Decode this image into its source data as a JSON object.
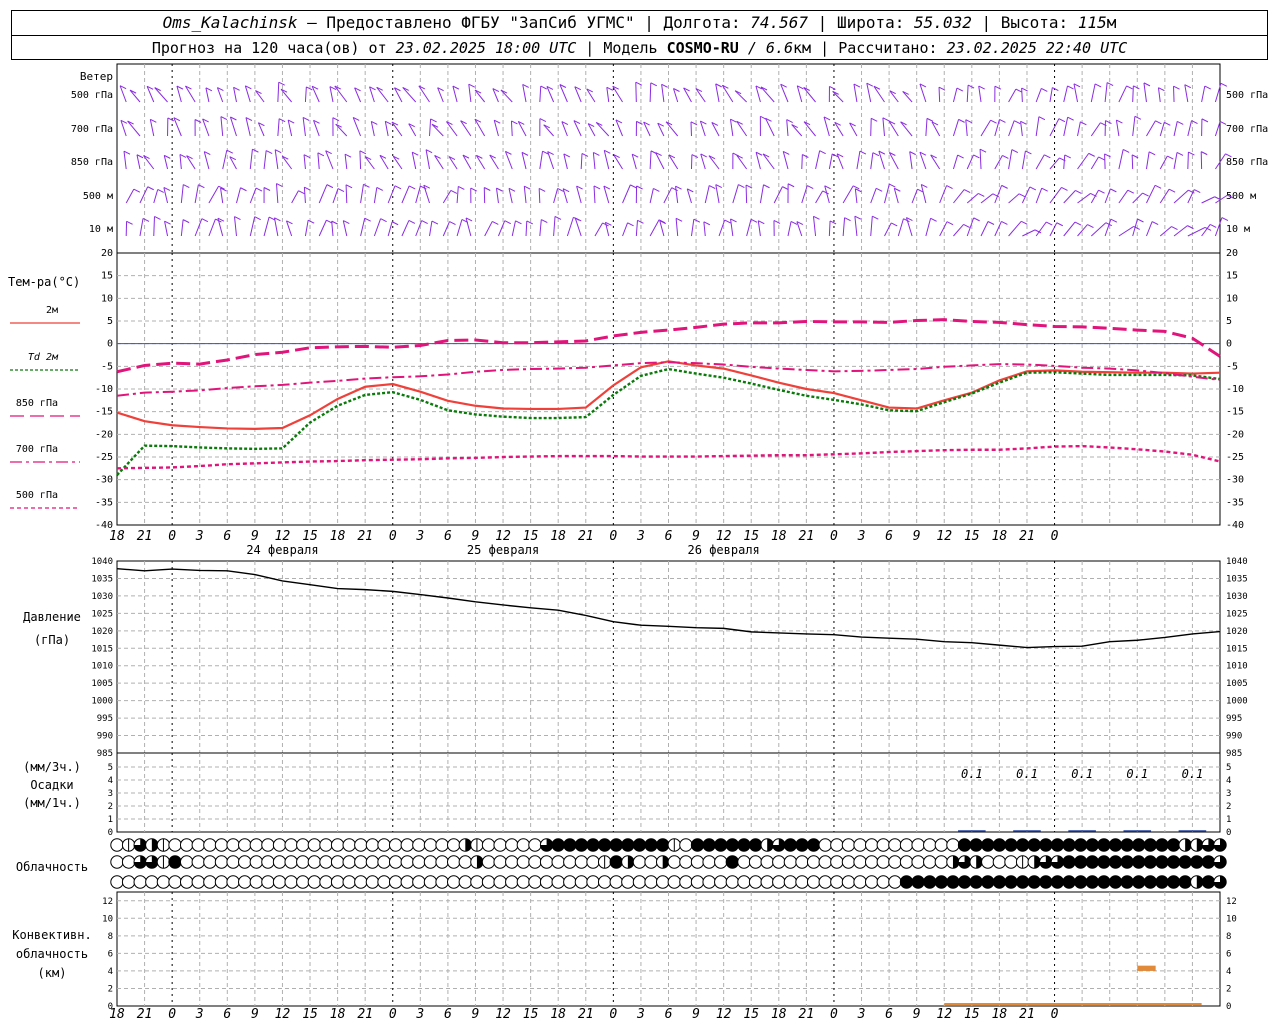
{
  "header": {
    "station": "Oms_Kalachinsk",
    "dash": " – ",
    "provider": "Предоставлено ФГБУ \"ЗапСиб УГМС\"",
    "lon_label": "Долгота:",
    "lon_value": "74.567",
    "lat_label": "Широта:",
    "lat_value": "55.032",
    "alt_label": "Высота:",
    "alt_value": "115",
    "alt_unit": "м",
    "sep": " | ",
    "forecast_prefix": "Прогноз на 120 часа(ов) от ",
    "forecast_time": "23.02.2025 18:00 UTC",
    "model_label": "Модель ",
    "model_name": "COSMO-RU",
    "model_res": " / 6.6",
    "model_res_unit": "км",
    "calc_label": "Рассчитано: ",
    "calc_time": "23.02.2025 22:40 UTC"
  },
  "chart_data": [
    {
      "type": "wind-barbs",
      "label": "Ветер",
      "levels": [
        "500 гПа",
        "700 гПа",
        "850 гПа",
        "500 м",
        "10 м"
      ],
      "color": "#8a2be2"
    },
    {
      "type": "line",
      "label": "Тем-ра(°C)",
      "ylim": [
        -40,
        20
      ],
      "yticks": [
        20,
        15,
        10,
        5,
        0,
        -5,
        -10,
        -15,
        -20,
        -25,
        -30,
        -35,
        -40
      ],
      "x": [
        0,
        3,
        6,
        9,
        12,
        15,
        18,
        21,
        24,
        27,
        30,
        33,
        36,
        39,
        42,
        45,
        48,
        51,
        54,
        57,
        60,
        63,
        66,
        69,
        72,
        75,
        78,
        81,
        84,
        87,
        90,
        93,
        96,
        99,
        102,
        105,
        108,
        111,
        114,
        117,
        120
      ],
      "series": [
        {
          "name": "2м",
          "color": "#f0403a",
          "dash": "solid",
          "values": [
            -15.2,
            -17.1,
            -18.0,
            -18.4,
            -18.7,
            -18.8,
            -18.6,
            -15.8,
            -12.2,
            -9.5,
            -8.9,
            -10.6,
            -12.6,
            -13.7,
            -14.3,
            -14.4,
            -14.4,
            -14.1,
            -9.2,
            -5.2,
            -3.9,
            -4.8,
            -5.5,
            -7.0,
            -8.6,
            -10.0,
            -10.9,
            -12.5,
            -14.1,
            -14.3,
            -12.5,
            -10.8,
            -8.1,
            -6.1,
            -5.9,
            -6.2,
            -6.3,
            -6.4,
            -6.4,
            -6.6,
            -6.4
          ]
        },
        {
          "name": "Td 2м",
          "color": "#0a7a0a",
          "dash": "dot",
          "values": [
            -29.0,
            -22.5,
            -22.6,
            -22.9,
            -23.1,
            -23.2,
            -23.1,
            -17.4,
            -13.7,
            -11.3,
            -10.7,
            -12.4,
            -14.7,
            -15.6,
            -16.1,
            -16.4,
            -16.4,
            -16.2,
            -11.3,
            -7.1,
            -5.6,
            -6.6,
            -7.5,
            -8.8,
            -10.2,
            -11.5,
            -12.4,
            -13.4,
            -14.7,
            -14.9,
            -12.9,
            -11.0,
            -8.6,
            -6.4,
            -6.3,
            -6.6,
            -6.9,
            -6.9,
            -6.9,
            -7.0,
            -7.8
          ]
        },
        {
          "name": "850 гПа",
          "color": "#e0147a",
          "dash": "longdash",
          "values": [
            -6.2,
            -4.8,
            -4.3,
            -4.5,
            -3.6,
            -2.4,
            -1.9,
            -0.9,
            -0.7,
            -0.6,
            -0.8,
            -0.4,
            0.7,
            0.8,
            0.2,
            0.2,
            0.4,
            0.6,
            1.7,
            2.5,
            3.0,
            3.6,
            4.3,
            4.6,
            4.6,
            4.9,
            4.8,
            4.8,
            4.7,
            5.1,
            5.3,
            4.9,
            4.7,
            4.2,
            3.8,
            3.7,
            3.4,
            3.0,
            2.7,
            1.2,
            -2.8
          ]
        },
        {
          "name": "700 гПа",
          "color": "#e0147a",
          "dash": "dashdot",
          "values": [
            -11.5,
            -10.8,
            -10.6,
            -10.3,
            -9.8,
            -9.4,
            -9.1,
            -8.6,
            -8.2,
            -7.7,
            -7.4,
            -7.2,
            -6.8,
            -6.2,
            -5.8,
            -5.6,
            -5.5,
            -5.3,
            -4.8,
            -4.3,
            -4.1,
            -4.3,
            -4.6,
            -5.1,
            -5.5,
            -5.8,
            -6.1,
            -6.0,
            -5.8,
            -5.6,
            -5.1,
            -4.8,
            -4.5,
            -4.6,
            -4.9,
            -5.3,
            -5.5,
            -5.9,
            -6.5,
            -7.3,
            -8.0
          ]
        },
        {
          "name": "500 гПа",
          "color": "#e0147a",
          "dash": "shortdash",
          "values": [
            -27.5,
            -27.4,
            -27.3,
            -27.0,
            -26.6,
            -26.4,
            -26.2,
            -26.0,
            -25.9,
            -25.7,
            -25.6,
            -25.5,
            -25.3,
            -25.2,
            -25.0,
            -24.9,
            -24.8,
            -24.8,
            -24.8,
            -24.9,
            -24.9,
            -24.9,
            -24.8,
            -24.7,
            -24.6,
            -24.6,
            -24.4,
            -24.2,
            -23.9,
            -23.7,
            -23.5,
            -23.4,
            -23.4,
            -23.1,
            -22.7,
            -22.6,
            -22.9,
            -23.3,
            -23.8,
            -24.5,
            -26.0
          ]
        }
      ]
    },
    {
      "type": "line",
      "label1": "Давление",
      "label2": "(гПа)",
      "ylim": [
        985,
        1040
      ],
      "yticks": [
        1040,
        1035,
        1030,
        1025,
        1020,
        1015,
        1010,
        1005,
        1000,
        995,
        990,
        985
      ],
      "x": [
        0,
        3,
        6,
        9,
        12,
        15,
        18,
        21,
        24,
        27,
        30,
        33,
        36,
        39,
        42,
        45,
        48,
        51,
        54,
        57,
        60,
        63,
        66,
        69,
        72,
        75,
        78,
        81,
        84,
        87,
        90,
        93,
        96,
        99,
        102,
        105,
        108,
        111,
        114,
        117,
        120
      ],
      "series": [
        {
          "name": "",
          "color": "#000000",
          "values": [
            1037.8,
            1037.2,
            1037.7,
            1037.3,
            1037.2,
            1036.1,
            1034.3,
            1033.2,
            1032.1,
            1031.8,
            1031.3,
            1030.4,
            1029.4,
            1028.3,
            1027.4,
            1026.6,
            1025.9,
            1024.4,
            1022.6,
            1021.6,
            1021.3,
            1020.9,
            1020.7,
            1019.7,
            1019.4,
            1019.1,
            1018.9,
            1018.2,
            1017.9,
            1017.6,
            1016.9,
            1016.6,
            1015.9,
            1015.2,
            1015.5,
            1015.6,
            1016.9,
            1017.3,
            1018.1,
            1019.1,
            1019.8
          ]
        }
      ]
    },
    {
      "type": "bar",
      "label1": "(мм/3ч.)",
      "label2": "Осадки",
      "label3": "(мм/1ч.)",
      "ylim": [
        0,
        5
      ],
      "yticks": [
        5,
        4,
        3,
        2,
        1,
        0
      ],
      "amounts": [
        {
          "x": 93,
          "label": "0.1"
        },
        {
          "x": 99,
          "label": "0.1"
        },
        {
          "x": 105,
          "label": "0.1"
        },
        {
          "x": 111,
          "label": "0.1"
        },
        {
          "x": 117,
          "label": "0.1"
        }
      ]
    },
    {
      "type": "cloud-symbols",
      "label": "Облачность",
      "rows": [
        "abdcbaaaaaaaaaaaaaaaaaaaaaaaaacbaaaaadeeeeeeeeeebaeeeeeecdeeeaaaaaaaaaaaaeeeeeeeeeeeeeeeeeeeccdd",
        "aaddbeaaaaaaaaaaaaaaaaaaaaaaaaacaaaaaaaaaabecaacaaaaaeaaaaaaaaaaaaaaaaaacdcaaabcddeeeeeeeeeeeeed",
        "aaaaaaaaaaaaaaaaaaaaaaaaaaaaaaaaaaaaaaaaaaaaaaaaaaaaaaaaaaaaaaaaaaaaeeeeeeeeeeeeeeeeeeeeeeeeeced"
      ]
    },
    {
      "type": "bar",
      "label1": "Конвективн.",
      "label2": "облачность",
      "label3": "(км)",
      "ylim": [
        0,
        13
      ],
      "yticks": [
        12,
        10,
        8,
        6,
        4,
        2,
        0
      ],
      "color": "#e08a3a",
      "bars": [
        {
          "x0": 111,
          "x1": 113,
          "bottom": 4.0,
          "top": 4.6
        }
      ],
      "base_band": [
        90,
        118
      ]
    },
    {
      "type": "time-axis",
      "hour_labels": [
        "18",
        "21",
        "0",
        "3",
        "6",
        "9",
        "12",
        "15",
        "18",
        "21",
        "0",
        "3",
        "6",
        "9",
        "12",
        "15",
        "18",
        "21",
        "0",
        "3",
        "6",
        "9",
        "12",
        "15",
        "18",
        "21",
        "0",
        "3",
        "6",
        "9",
        "12",
        "15",
        "18",
        "21",
        "0"
      ],
      "dates": [
        "24 февраля",
        "25 февраля",
        "26 февраля"
      ]
    }
  ]
}
